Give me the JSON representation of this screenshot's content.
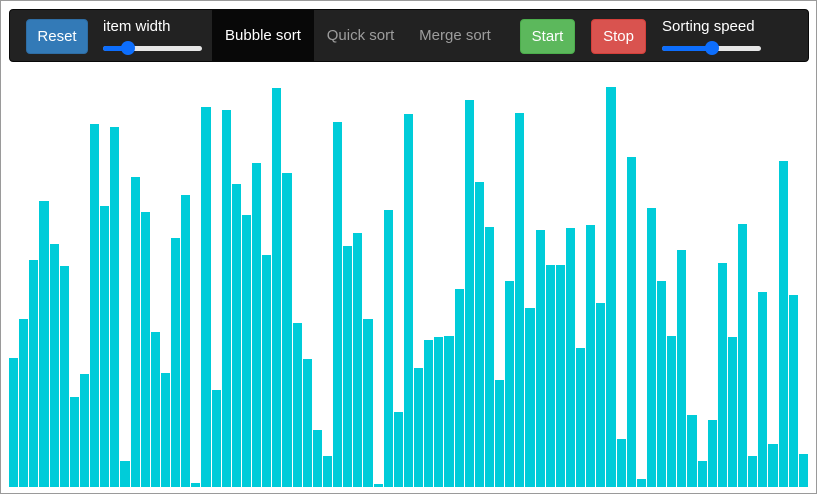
{
  "toolbar": {
    "reset_label": "Reset",
    "item_width_label": "item width",
    "item_width_value": 0.25,
    "tabs": [
      {
        "label": "Bubble sort",
        "active": true
      },
      {
        "label": "Quick sort",
        "active": false
      },
      {
        "label": "Merge sort",
        "active": false
      }
    ],
    "start_label": "Start",
    "stop_label": "Stop",
    "sorting_speed_label": "Sorting speed",
    "sorting_speed_value": 0.5
  },
  "colors": {
    "bar": "#00ccd9",
    "navbar": "#222222",
    "reset": "#337ab7",
    "start": "#5cb85c",
    "stop": "#d9534f",
    "slider": "#0d6efd"
  },
  "bars": {
    "max_value": 420,
    "values": [
      129,
      168,
      227,
      286,
      243,
      221,
      90,
      113,
      363,
      281,
      360,
      26,
      310,
      275,
      155,
      114,
      249,
      292,
      4,
      380,
      97,
      377,
      303,
      272,
      324,
      232,
      399,
      314,
      164,
      128,
      57,
      31,
      365,
      241,
      254,
      168,
      3,
      277,
      75,
      373,
      119,
      147,
      150,
      151,
      198,
      387,
      305,
      260,
      107,
      206,
      374,
      179,
      257,
      222,
      222,
      259,
      139,
      262,
      184,
      400,
      48,
      330,
      8,
      279,
      206,
      151,
      237,
      72,
      26,
      67,
      224,
      150,
      263,
      31,
      195,
      43,
      326,
      192,
      33
    ],
    "zero_indices": [],
    "zero_value": 0
  }
}
